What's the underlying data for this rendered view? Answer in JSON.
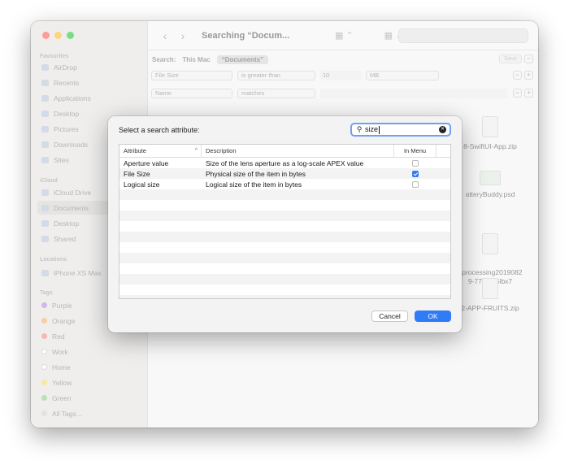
{
  "window": {
    "title": "Searching “Docum...",
    "colors": {
      "close": "#ff5f57",
      "minimize": "#febc2e",
      "zoom": "#28c840"
    }
  },
  "sidebar": {
    "favourites_label": "Favourites",
    "favourites": [
      {
        "label": "AirDrop",
        "icon": "airdrop-icon"
      },
      {
        "label": "Recents",
        "icon": "clock-icon"
      },
      {
        "label": "Applications",
        "icon": "applications-icon"
      },
      {
        "label": "Desktop",
        "icon": "desktop-icon"
      },
      {
        "label": "Pictures",
        "icon": "pictures-icon"
      },
      {
        "label": "Downloads",
        "icon": "downloads-icon"
      },
      {
        "label": "Sites",
        "icon": "folder-icon"
      }
    ],
    "icloud_label": "iCloud",
    "icloud": [
      {
        "label": "iCloud Drive",
        "icon": "cloud-icon"
      },
      {
        "label": "Documents",
        "icon": "document-folder-icon",
        "active": true
      },
      {
        "label": "Desktop",
        "icon": "desktop-icon"
      },
      {
        "label": "Shared",
        "icon": "shared-folder-icon"
      }
    ],
    "locations_label": "Locations",
    "locations": [
      {
        "label": "iPhone XS Max",
        "icon": "phone-icon"
      }
    ],
    "tags_label": "Tags",
    "tags": [
      {
        "label": "Purple",
        "color": "#b48be0"
      },
      {
        "label": "Orange",
        "color": "#f4b169"
      },
      {
        "label": "Red",
        "color": "#f08a8a"
      },
      {
        "label": "Work",
        "color": "#ffffff"
      },
      {
        "label": "Home",
        "color": "#ffffff"
      },
      {
        "label": "Yellow",
        "color": "#f3dc6a"
      },
      {
        "label": "Green",
        "color": "#8ad08a"
      },
      {
        "label": "All Tags...",
        "color": "#d0d0d0"
      }
    ]
  },
  "search_bar": {
    "label": "Search:",
    "scope_this_mac": "This Mac",
    "scope_documents": "“Documents”",
    "save_label": "Save"
  },
  "criteria": [
    {
      "attribute": "File Size",
      "operator": "is greater than",
      "value": "10",
      "unit": "MB"
    },
    {
      "attribute": "Name",
      "operator": "matches",
      "value": ""
    }
  ],
  "files": [
    {
      "name": "8-SwiftUI-App.zip"
    },
    {
      "name": "atteryBuddy.psd"
    },
    {
      "name": "_processing2019082\n9-7751-65lbx7"
    },
    {
      "name": "2-APP-FRUITS.zip"
    }
  ],
  "dialog": {
    "title": "Select a search attribute:",
    "search_value": "size",
    "columns": {
      "attribute": "Attribute",
      "description": "Description",
      "in_menu": "In Menu"
    },
    "rows": [
      {
        "attribute": "Aperture value",
        "description": "Size of the lens aperture as a log-scale APEX value",
        "in_menu": false
      },
      {
        "attribute": "File Size",
        "description": "Physical size of the item in bytes",
        "in_menu": true
      },
      {
        "attribute": "Logical size",
        "description": "Logical size of the item in bytes",
        "in_menu": false
      }
    ],
    "cancel_label": "Cancel",
    "ok_label": "OK",
    "accent": "#2f7cf6"
  }
}
